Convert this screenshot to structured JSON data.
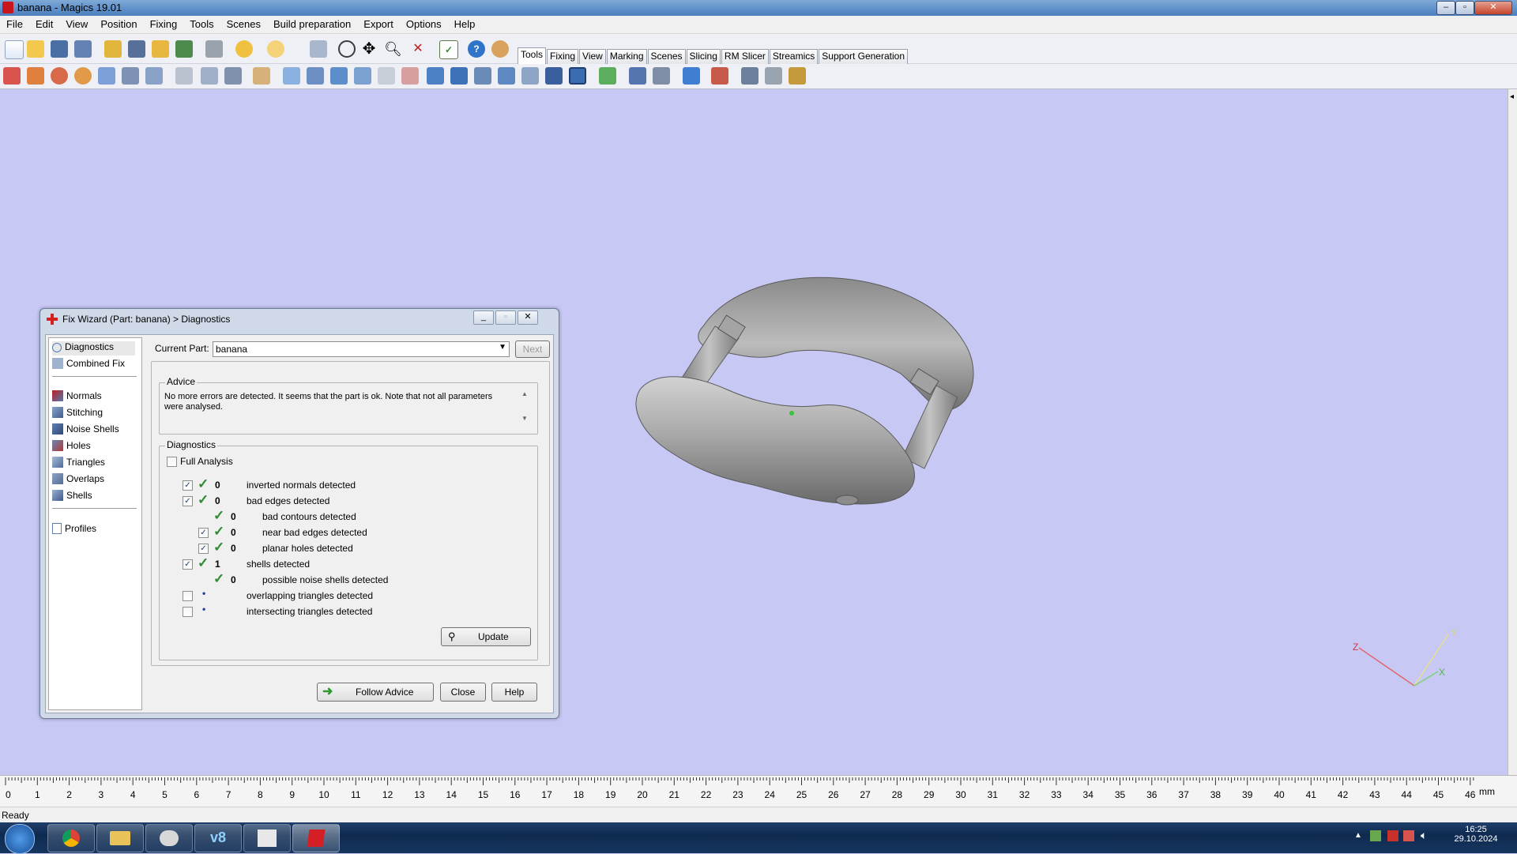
{
  "window": {
    "title": "banana - Magics 19.01"
  },
  "menu": [
    "File",
    "Edit",
    "View",
    "Position",
    "Fixing",
    "Tools",
    "Scenes",
    "Build preparation",
    "Export",
    "Options",
    "Help"
  ],
  "tabs": [
    "Tools",
    "Fixing",
    "View",
    "Marking",
    "Scenes",
    "Slicing",
    "RM Slicer",
    "Streamics",
    "Support Generation"
  ],
  "active_tab": "Tools",
  "dialog": {
    "title": "Fix Wizard (Part: banana) > Diagnostics",
    "nav_top": [
      "Diagnostics",
      "Combined Fix"
    ],
    "nav_tools": [
      "Normals",
      "Stitching",
      "Noise Shells",
      "Holes",
      "Triangles",
      "Overlaps",
      "Shells"
    ],
    "nav_bottom": [
      "Profiles"
    ],
    "current_part_label": "Current Part:",
    "current_part_value": "banana",
    "next_label": "Next",
    "advice_title": "Advice",
    "advice_text": "No more errors are detected. It seems that the part is ok. Note that not all parameters were analysed.",
    "diagnostics_title": "Diagnostics",
    "full_analysis_label": "Full Analysis",
    "rows": [
      {
        "checked": true,
        "status": "check",
        "count": "0",
        "label": "inverted normals detected",
        "level": 0
      },
      {
        "checked": true,
        "status": "check",
        "count": "0",
        "label": "bad edges detected",
        "level": 0
      },
      {
        "checked": null,
        "status": "check",
        "count": "0",
        "label": "bad contours detected",
        "level": 1
      },
      {
        "checked": true,
        "status": "check",
        "count": "0",
        "label": "near bad edges detected",
        "level": 1
      },
      {
        "checked": true,
        "status": "check",
        "count": "0",
        "label": "planar holes detected",
        "level": 1
      },
      {
        "checked": true,
        "status": "check",
        "count": "1",
        "label": "shells detected",
        "level": 0
      },
      {
        "checked": null,
        "status": "check",
        "count": "0",
        "label": "possible noise shells detected",
        "level": 1
      },
      {
        "checked": false,
        "status": "dot",
        "count": "",
        "label": "overlapping triangles detected",
        "level": 0
      },
      {
        "checked": false,
        "status": "dot",
        "count": "",
        "label": "intersecting triangles detected",
        "level": 0
      }
    ],
    "update_label": "Update",
    "follow_advice_label": "Follow Advice",
    "close_label": "Close",
    "help_label": "Help"
  },
  "ruler": {
    "ticks": [
      "0",
      "1",
      "2",
      "3",
      "4",
      "5",
      "6",
      "7",
      "8",
      "9",
      "10",
      "11",
      "12",
      "13",
      "14",
      "15",
      "16",
      "17",
      "18",
      "19",
      "20",
      "21",
      "22",
      "23",
      "24",
      "25",
      "26",
      "27",
      "28",
      "29",
      "30",
      "31",
      "32",
      "33",
      "34",
      "35",
      "36",
      "37",
      "38",
      "39",
      "40",
      "41",
      "42",
      "43",
      "44",
      "45",
      "46"
    ],
    "unit": "mm"
  },
  "axes": {
    "x": "X",
    "y": "Y",
    "z": "Z"
  },
  "status": "Ready",
  "clock": {
    "time": "16:25",
    "date": "29.10.2024"
  },
  "colors": {
    "viewport_bg": "#c8c8f4",
    "check_green": "#2e8b2e",
    "title_bar": "#5d8fc9"
  }
}
